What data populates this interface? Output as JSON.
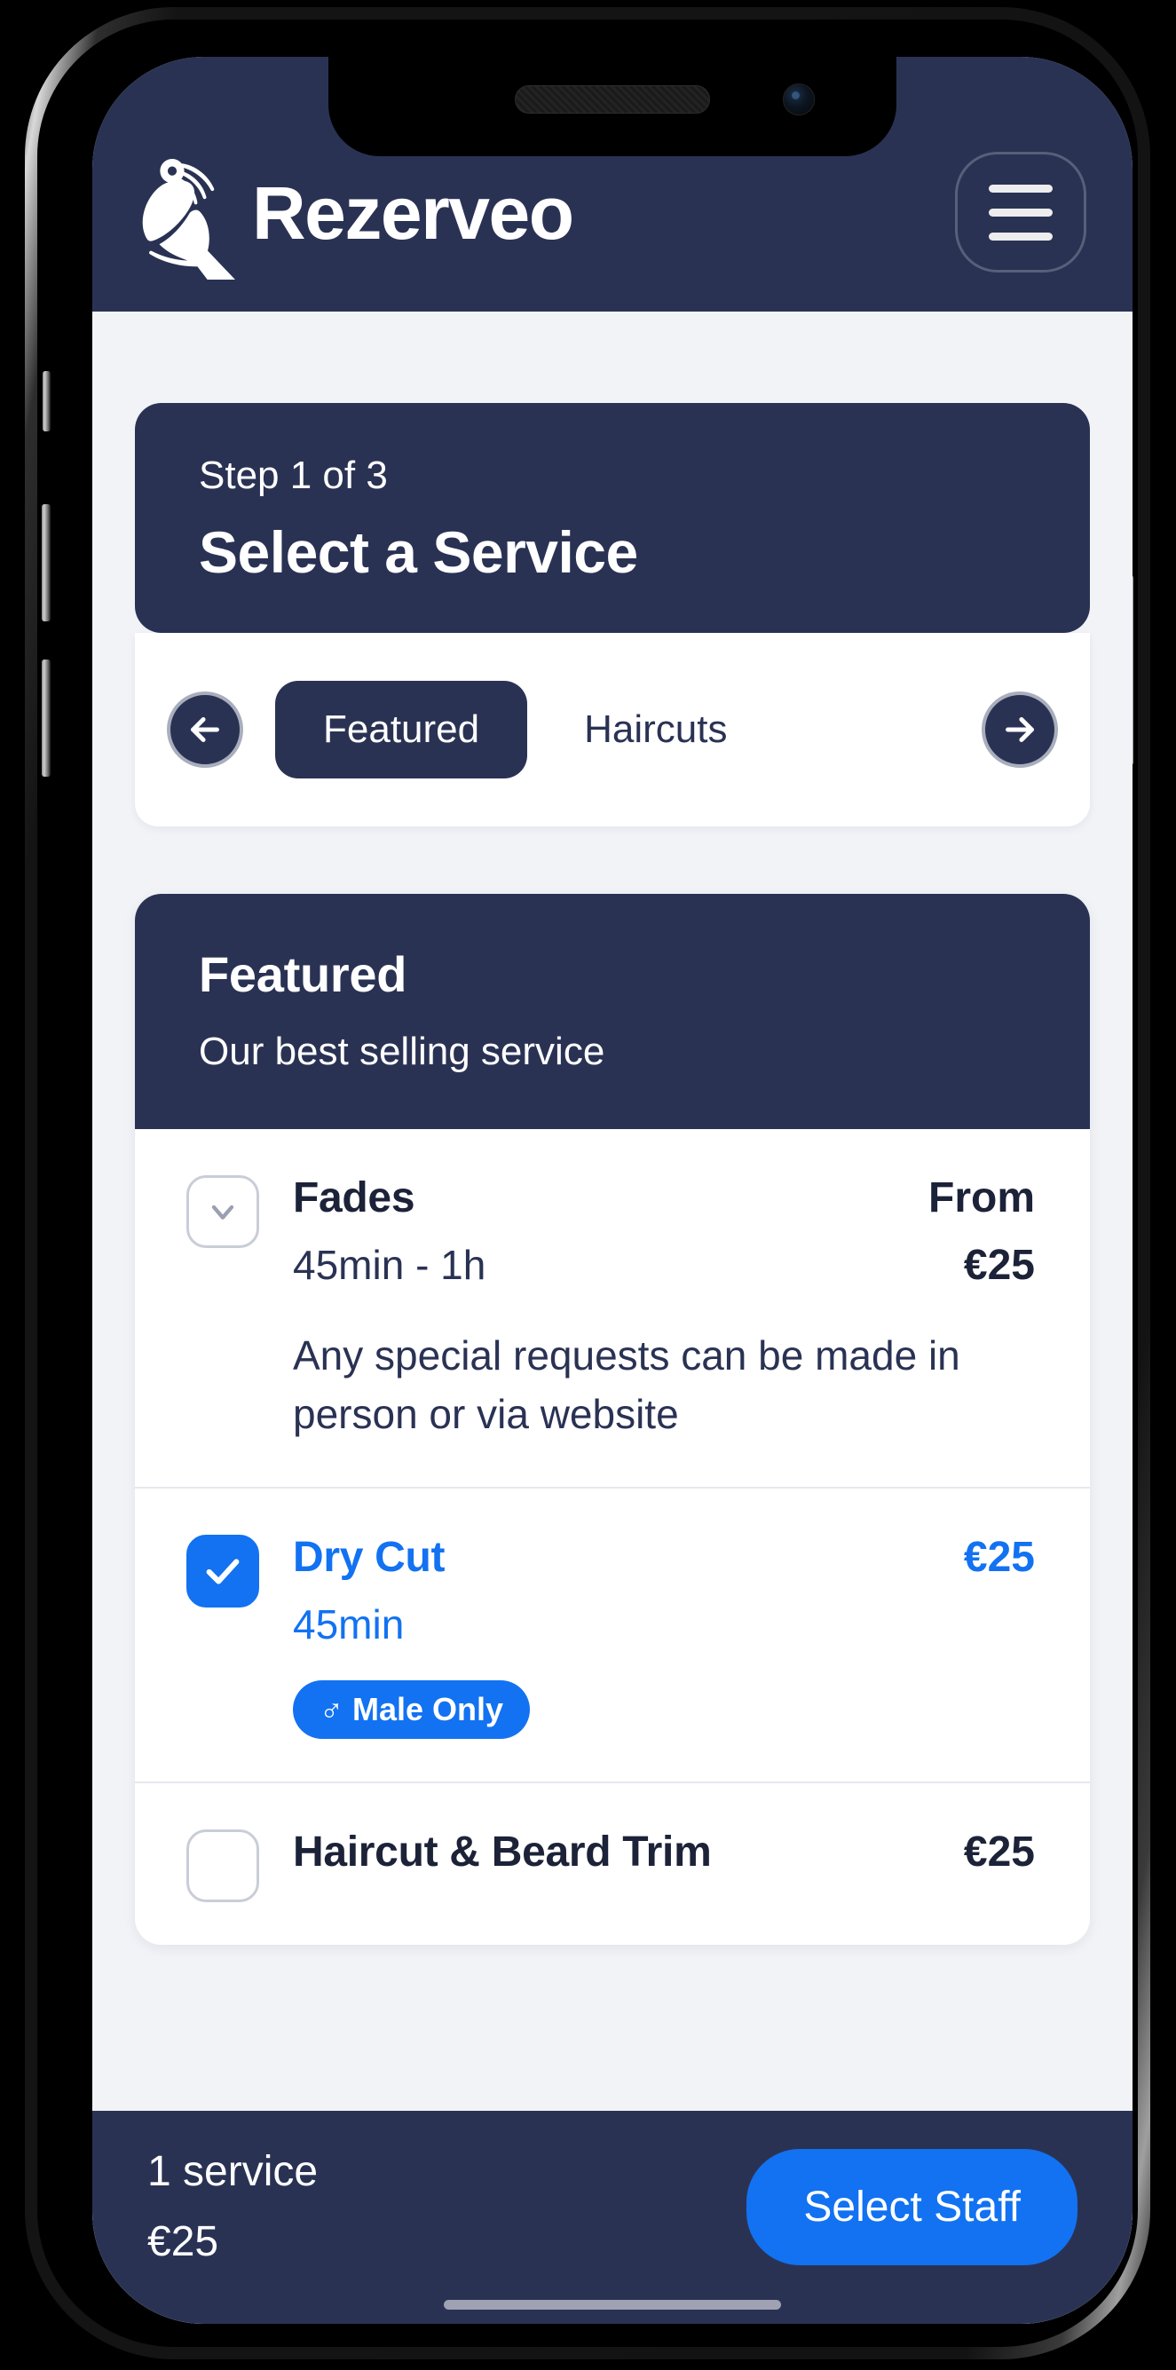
{
  "brand": {
    "name": "Rezerveo",
    "logo_icon": "peacock-logo-icon"
  },
  "header": {
    "menu_icon": "hamburger-menu-icon"
  },
  "step": {
    "eyebrow": "Step 1 of 3",
    "title": "Select a Service"
  },
  "tabs": {
    "prev_icon": "arrow-left-icon",
    "next_icon": "arrow-right-icon",
    "items": [
      {
        "label": "Featured",
        "active": true
      },
      {
        "label": "Haircuts",
        "active": false
      }
    ]
  },
  "featured_card": {
    "title": "Featured",
    "subtitle": "Our best selling service"
  },
  "services": [
    {
      "name": "Fades",
      "duration": "45min - 1h",
      "price_prefix": "From",
      "price": "€25",
      "description": "Any special requests can be made in person or via website",
      "selected": false,
      "checkbox_icon": "chevron-down-icon"
    },
    {
      "name": "Dry Cut",
      "duration": "45min",
      "price": "€25",
      "badge": "Male Only",
      "badge_symbol": "♂",
      "selected": true,
      "checkbox_icon": "check-icon"
    },
    {
      "name": "Haircut & Beard Trim",
      "price": "€25",
      "selected": false,
      "checkbox_icon": "empty-checkbox-icon"
    }
  ],
  "bottom_bar": {
    "service_count": "1 service",
    "total": "€25",
    "cta_label": "Select Staff"
  },
  "colors": {
    "navy": "#2A3254",
    "accent_blue": "#1272F1",
    "page_bg": "#F1F3F7",
    "card_white": "#FFFFFF"
  }
}
